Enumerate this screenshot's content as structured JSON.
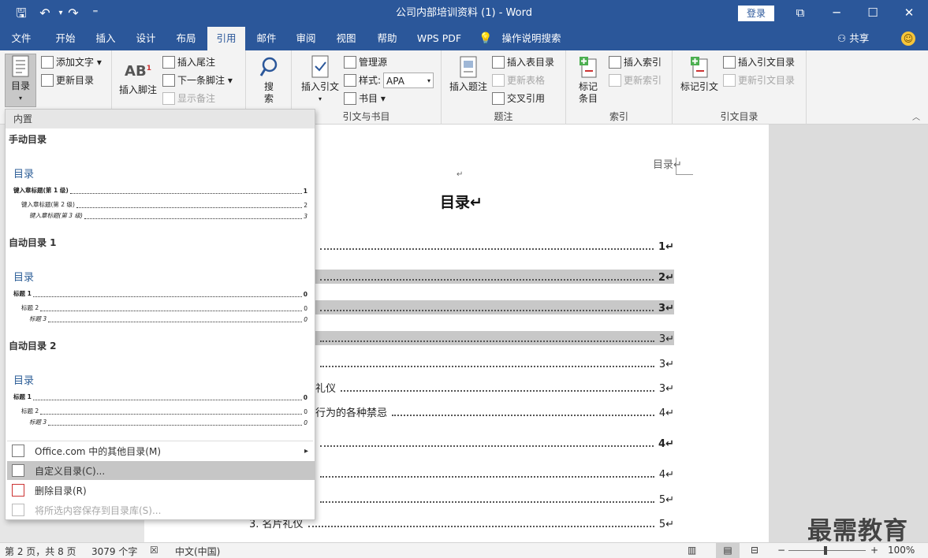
{
  "window": {
    "title": "公司内部培训资料 (1)  -  Word",
    "login": "登录",
    "restore": "⧉",
    "minimize": "─",
    "maximize": "☐",
    "close": "✕"
  },
  "qat": {
    "save": "🖫",
    "undo": "↶",
    "undo_arrow": "▾",
    "redo": "↷",
    "customize": "⁼"
  },
  "tabs": [
    "文件",
    "开始",
    "插入",
    "设计",
    "布局",
    "引用",
    "邮件",
    "审阅",
    "视图",
    "帮助",
    "WPS PDF",
    "操作说明搜索"
  ],
  "active_tab": "引用",
  "share": "共享",
  "smiley": "☺",
  "ribbon": {
    "toc": {
      "big": "目录",
      "add_text": "添加文字 ▾",
      "update": "更新目录"
    },
    "footnotes": {
      "insert_footnote": "插入脚注",
      "insert_endnote": "插入尾注",
      "next_footnote": "下一条脚注 ▾",
      "show_notes": "显示备注"
    },
    "search": {
      "label1": "搜",
      "label2": "索"
    },
    "citations": {
      "insert_citation": "插入引文",
      "manage": "管理源",
      "style_label": "样式:",
      "style_value": "APA",
      "bibliography": "书目 ▾",
      "group": "引文与书目"
    },
    "captions": {
      "insert_caption": "插入题注",
      "insert_figure_table": "插入表目录",
      "update_table": "更新表格",
      "cross_ref": "交叉引用",
      "group": "题注"
    },
    "index": {
      "mark_entry_1": "标记",
      "mark_entry_2": "条目",
      "insert_index": "插入索引",
      "update_index": "更新索引",
      "group": "索引"
    },
    "toa": {
      "mark_citation": "标记引文",
      "insert_toa": "插入引文目录",
      "update_toa": "更新引文目录",
      "group": "引文目录"
    }
  },
  "dropdown": {
    "header": "内置",
    "galleries": [
      {
        "name": "手动目录",
        "title": "目录",
        "lines": [
          {
            "text": "键入章标题(第 1 级)",
            "page": "1"
          },
          {
            "text": "键入章标题(第 2 级)",
            "page": "2"
          },
          {
            "text": "键入章标题(第 3 级)",
            "page": "3"
          }
        ]
      },
      {
        "name": "自动目录 1",
        "title": "目录",
        "lines": [
          {
            "text": "标题 1",
            "page": "0"
          },
          {
            "text": "标题 2",
            "page": "0"
          },
          {
            "text": "标题 3",
            "page": "0"
          }
        ]
      },
      {
        "name": "自动目录 2",
        "title": "目录",
        "lines": [
          {
            "text": "标题 1",
            "page": "0"
          },
          {
            "text": "标题 2",
            "page": "0"
          },
          {
            "text": "标题 3",
            "page": "0"
          }
        ]
      }
    ],
    "items": [
      "Office.com 中的其他目录(M)",
      "自定义目录(C)...",
      "删除目录(R)",
      "将所选内容保存到目录库(S)..."
    ],
    "submenu_arrow": "▸"
  },
  "document": {
    "header_text": "目录↵",
    "para_mark": "↵",
    "title": "目录↵",
    "toc_entries": [
      {
        "text": "",
        "page": "1↵",
        "bold": true,
        "hl": false
      },
      {
        "text": "",
        "page": "2↵",
        "bold": true,
        "hl": true
      },
      {
        "text": "",
        "page": "3↵",
        "bold": true,
        "hl": true
      },
      {
        "text": "",
        "page": "3↵",
        "bold": false,
        "hl": true
      },
      {
        "text": "",
        "page": "3↵",
        "bold": false,
        "hl": false
      },
      {
        "text": "礼仪",
        "page": "3↵",
        "bold": false,
        "hl": false
      },
      {
        "text": "行为的各种禁忌",
        "page": "4↵",
        "bold": false,
        "hl": false
      },
      {
        "text": "",
        "page": "4↵",
        "bold": true,
        "hl": false
      },
      {
        "text": "",
        "page": "4↵",
        "bold": false,
        "hl": false
      },
      {
        "text": "",
        "page": "5↵",
        "bold": false,
        "hl": false
      },
      {
        "text": "3.   名片礼仪",
        "page": "5↵",
        "bold": false,
        "hl": false
      }
    ]
  },
  "status": {
    "page": "第 2 页，共 8 页",
    "words": "3079 个字",
    "language": "中文(中国)",
    "zoom": "100%",
    "zoom_minus": "−",
    "zoom_plus": "+",
    "zoom_level": 1.0
  },
  "watermark": "最需教育"
}
